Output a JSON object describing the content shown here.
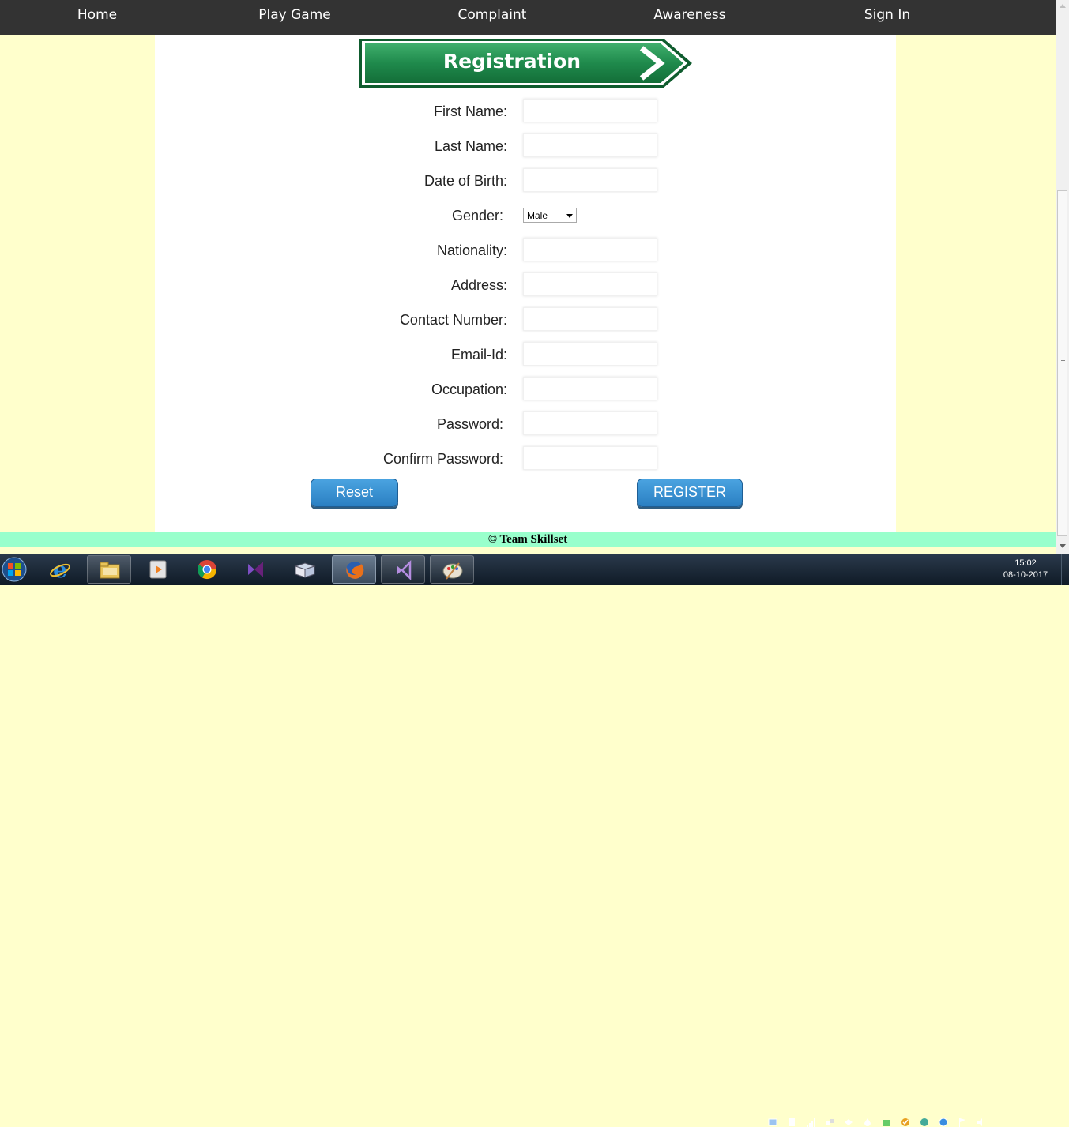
{
  "nav": {
    "items": [
      "Home",
      "Play Game",
      "Complaint",
      "Awareness",
      "Sign In"
    ]
  },
  "banner": {
    "text": "Registration"
  },
  "form": {
    "fields": [
      {
        "label": "First Name:",
        "value": ""
      },
      {
        "label": "Last Name:",
        "value": ""
      },
      {
        "label": "Date of Birth:",
        "value": ""
      },
      {
        "label": "Gender:",
        "value": "Male"
      },
      {
        "label": "Nationality:",
        "value": ""
      },
      {
        "label": "Address:",
        "value": ""
      },
      {
        "label": "Contact Number:",
        "value": ""
      },
      {
        "label": "Email-Id:",
        "value": ""
      },
      {
        "label": "Occupation:",
        "value": ""
      },
      {
        "label": "Password:",
        "value": ""
      },
      {
        "label": "Confirm Password:",
        "value": ""
      }
    ],
    "reset_label": "Reset",
    "register_label": "REGISTER"
  },
  "footer": {
    "text": "© Team Skillset"
  },
  "taskbar": {
    "apps": [
      "start-orb",
      "internet-explorer",
      "file-explorer",
      "media-player",
      "chrome",
      "visual-studio",
      "reader",
      "firefox",
      "visual-studio-2",
      "paint"
    ],
    "active_app": "firefox",
    "time": "15:02",
    "date": "08-10-2017"
  },
  "colors": {
    "nav_bg": "#333333",
    "page_bg": "#ffffcc",
    "footer_bg": "#99ffcc",
    "button_blue": "#2a7fc2",
    "sign_green": "#1f8a4c"
  }
}
